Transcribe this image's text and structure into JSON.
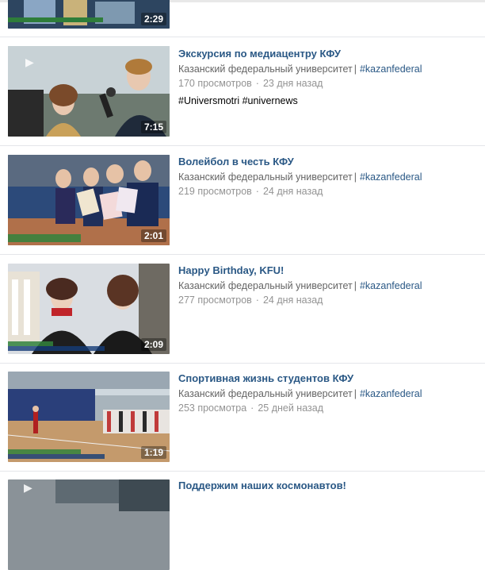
{
  "partial_top": {
    "duration": "2:29"
  },
  "videos": [
    {
      "title": "Экскурсия по медиацентру КФУ",
      "channel": "Казанский федеральный университет",
      "hashtag": "#kazanfederal",
      "views": "170 просмотров",
      "age": "23 дня назад",
      "extra_tags": "#Universmotri #univernews",
      "duration": "7:15"
    },
    {
      "title": "Волейбол в честь КФУ",
      "channel": "Казанский федеральный университет",
      "hashtag": "#kazanfederal",
      "views": "219 просмотров",
      "age": "24 дня назад",
      "duration": "2:01"
    },
    {
      "title": "Happy Birthday, KFU!",
      "channel": "Казанский федеральный университет",
      "hashtag": "#kazanfederal",
      "views": "277 просмотров",
      "age": "24 дня назад",
      "duration": "2:09"
    },
    {
      "title": "Спортивная жизнь студентов КФУ",
      "channel": "Казанский федеральный университет",
      "hashtag": "#kazanfederal",
      "views": "253 просмотра",
      "age": "25 дней назад",
      "duration": "1:19"
    },
    {
      "title": "Поддержим наших космонавтов!"
    }
  ],
  "colors": {
    "link": "#2a5885",
    "meta": "#656565",
    "muted": "#939393",
    "separator": "#e4e6ea"
  },
  "icons": {
    "separator_dot": "·"
  }
}
